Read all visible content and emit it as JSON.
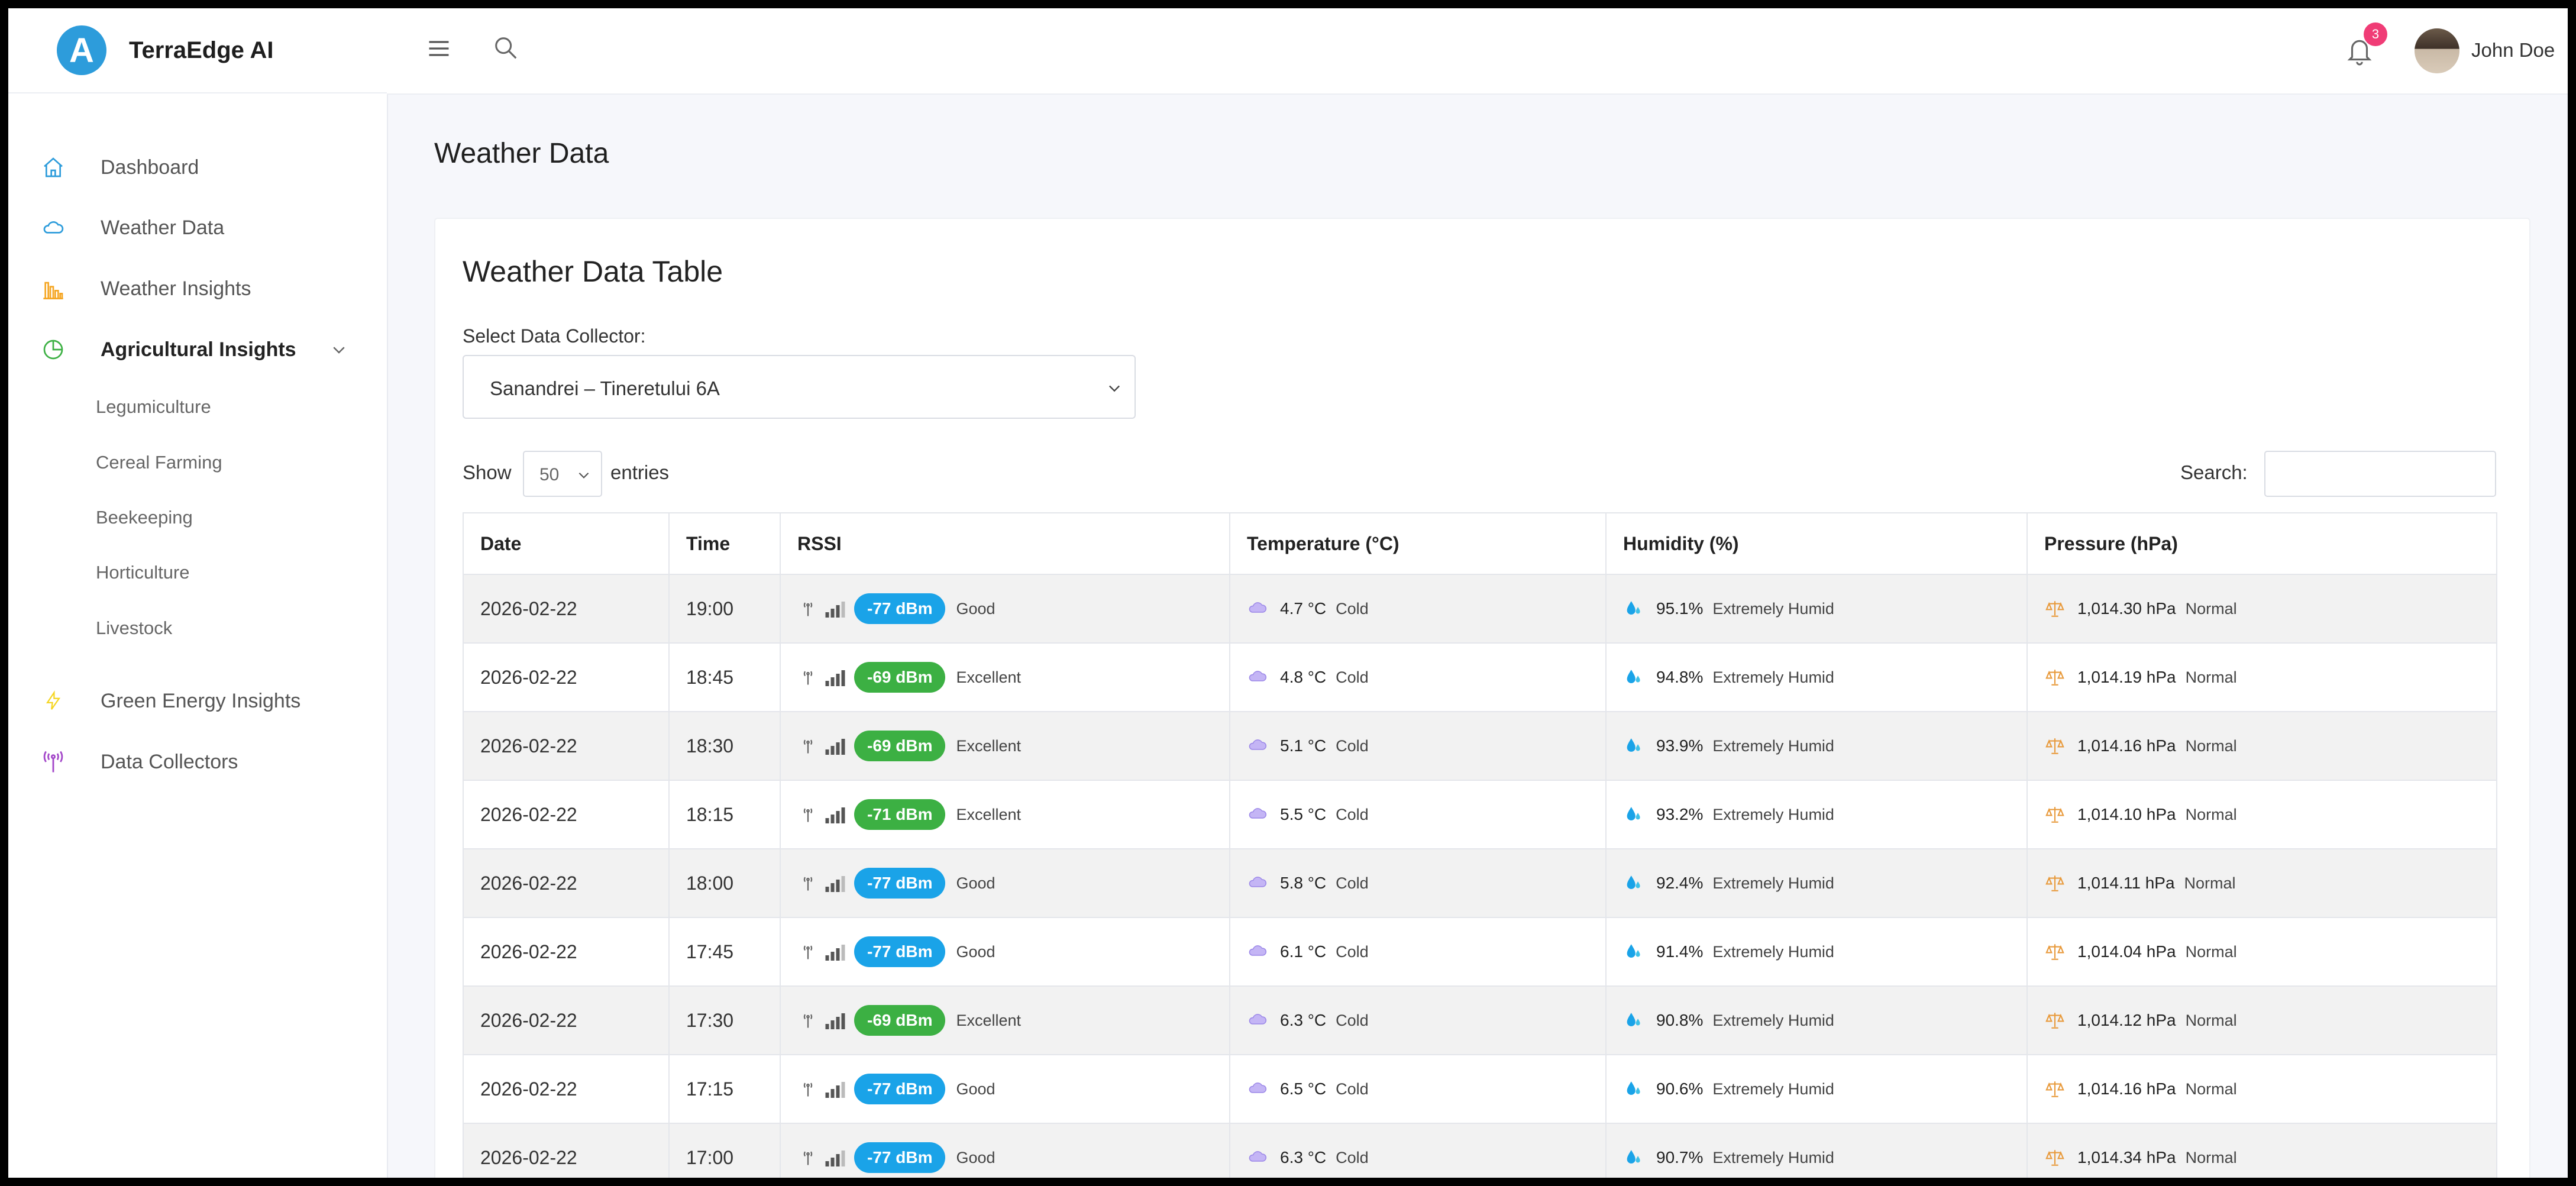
{
  "app": {
    "brand_name": "TerraEdge AI",
    "logo_letter": "A"
  },
  "sidebar": {
    "items": [
      {
        "label": "Dashboard",
        "icon": "home-icon",
        "color": "#2d9cdb"
      },
      {
        "label": "Weather Data",
        "icon": "cloud-icon",
        "color": "#2d9cdb"
      },
      {
        "label": "Weather Insights",
        "icon": "bar-chart-icon",
        "color": "#f5a623"
      },
      {
        "label": "Agricultural Insights",
        "icon": "pie-chart-icon",
        "color": "#3cb043"
      },
      {
        "label": "Green Energy Insights",
        "icon": "lightning-icon",
        "color": "#f5d623"
      },
      {
        "label": "Data Collectors",
        "icon": "antenna-icon",
        "color": "#a347c9"
      }
    ],
    "sub_items": [
      "Legumiculture",
      "Cereal Farming",
      "Beekeeping",
      "Horticulture",
      "Livestock"
    ]
  },
  "header": {
    "notification_count": "3",
    "user_name": "John Doe"
  },
  "page": {
    "title": "Weather Data"
  },
  "card": {
    "title": "Weather Data Table",
    "select_label": "Select Data Collector:",
    "selected_collector": "Sanandrei – Tineretului 6A",
    "show_label": "Show",
    "entries_value": "50",
    "entries_label": "entries",
    "search_label": "Search:"
  },
  "table": {
    "columns": [
      "Date",
      "Time",
      "RSSI",
      "Temperature (°C)",
      "Humidity (%)",
      "Pressure (hPa)"
    ],
    "rows": [
      {
        "date": "2026-02-22",
        "time": "19:00",
        "rssi": "-77 dBm",
        "rssi_label": "Good",
        "temp": "4.7 °C",
        "temp_label": "Cold",
        "hum": "95.1%",
        "hum_label": "Extremely Humid",
        "pres": "1,014.30 hPa",
        "pres_label": "Normal"
      },
      {
        "date": "2026-02-22",
        "time": "18:45",
        "rssi": "-69 dBm",
        "rssi_label": "Excellent",
        "temp": "4.8 °C",
        "temp_label": "Cold",
        "hum": "94.8%",
        "hum_label": "Extremely Humid",
        "pres": "1,014.19 hPa",
        "pres_label": "Normal"
      },
      {
        "date": "2026-02-22",
        "time": "18:30",
        "rssi": "-69 dBm",
        "rssi_label": "Excellent",
        "temp": "5.1 °C",
        "temp_label": "Cold",
        "hum": "93.9%",
        "hum_label": "Extremely Humid",
        "pres": "1,014.16 hPa",
        "pres_label": "Normal"
      },
      {
        "date": "2026-02-22",
        "time": "18:15",
        "rssi": "-71 dBm",
        "rssi_label": "Excellent",
        "temp": "5.5 °C",
        "temp_label": "Cold",
        "hum": "93.2%",
        "hum_label": "Extremely Humid",
        "pres": "1,014.10 hPa",
        "pres_label": "Normal"
      },
      {
        "date": "2026-02-22",
        "time": "18:00",
        "rssi": "-77 dBm",
        "rssi_label": "Good",
        "temp": "5.8 °C",
        "temp_label": "Cold",
        "hum": "92.4%",
        "hum_label": "Extremely Humid",
        "pres": "1,014.11 hPa",
        "pres_label": "Normal"
      },
      {
        "date": "2026-02-22",
        "time": "17:45",
        "rssi": "-77 dBm",
        "rssi_label": "Good",
        "temp": "6.1 °C",
        "temp_label": "Cold",
        "hum": "91.4%",
        "hum_label": "Extremely Humid",
        "pres": "1,014.04 hPa",
        "pres_label": "Normal"
      },
      {
        "date": "2026-02-22",
        "time": "17:30",
        "rssi": "-69 dBm",
        "rssi_label": "Excellent",
        "temp": "6.3 °C",
        "temp_label": "Cold",
        "hum": "90.8%",
        "hum_label": "Extremely Humid",
        "pres": "1,014.12 hPa",
        "pres_label": "Normal"
      },
      {
        "date": "2026-02-22",
        "time": "17:15",
        "rssi": "-77 dBm",
        "rssi_label": "Good",
        "temp": "6.5 °C",
        "temp_label": "Cold",
        "hum": "90.6%",
        "hum_label": "Extremely Humid",
        "pres": "1,014.16 hPa",
        "pres_label": "Normal"
      },
      {
        "date": "2026-02-22",
        "time": "17:00",
        "rssi": "-77 dBm",
        "rssi_label": "Good",
        "temp": "6.3 °C",
        "temp_label": "Cold",
        "hum": "90.7%",
        "hum_label": "Extremely Humid",
        "pres": "1,014.34 hPa",
        "pres_label": "Normal"
      }
    ]
  },
  "colors": {
    "rssi_good": "#1aa3e8",
    "rssi_excellent": "#3cb043",
    "badge": "#f03c76"
  }
}
